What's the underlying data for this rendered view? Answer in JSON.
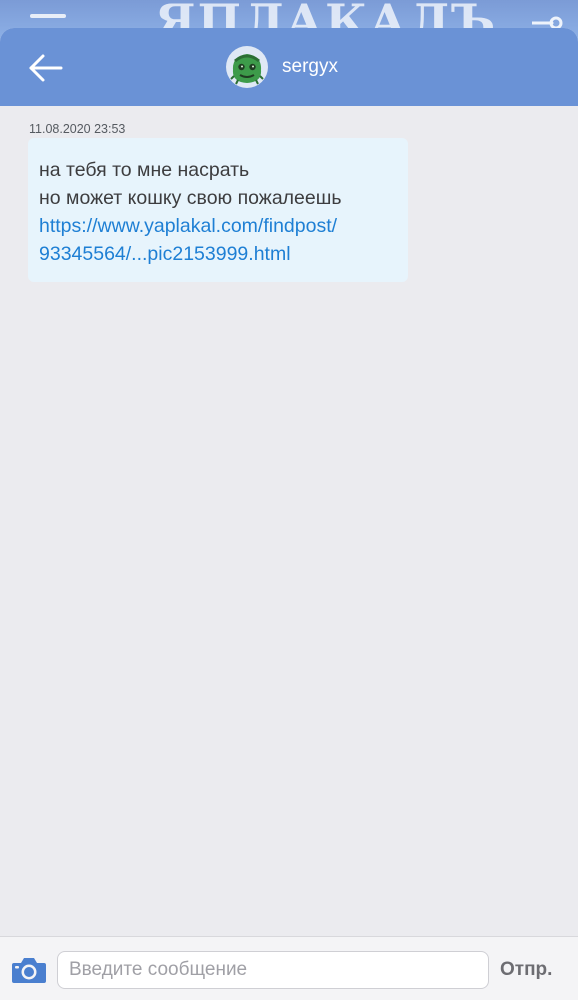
{
  "background_app": {
    "logo_text": "ЯПЛАКАЛЪ",
    "menu_icon": "hamburger-icon",
    "settings_icon": "settings-slider-icon"
  },
  "header": {
    "username": "sergyx",
    "back_icon": "back-arrow-icon",
    "avatar_icon": "green-monster-avatar"
  },
  "messages": [
    {
      "timestamp": "11.08.2020 23:53",
      "lines": [
        "на тебя то мне насрать",
        "но может кошку свою пожалеешь"
      ],
      "link_lines": [
        "https://www.yaplakal.com/findpost/",
        "93345564/...pic2153999.html"
      ]
    }
  ],
  "composer": {
    "placeholder": "Введите сообщение",
    "value": "",
    "send_label": "Отпр.",
    "camera_icon": "camera-icon"
  },
  "colors": {
    "header_bg": "#6a92d6",
    "chat_bg": "#ebebef",
    "bubble_bg": "#e7f4fc",
    "link": "#1e7fd4",
    "camera": "#4a7fcf"
  }
}
